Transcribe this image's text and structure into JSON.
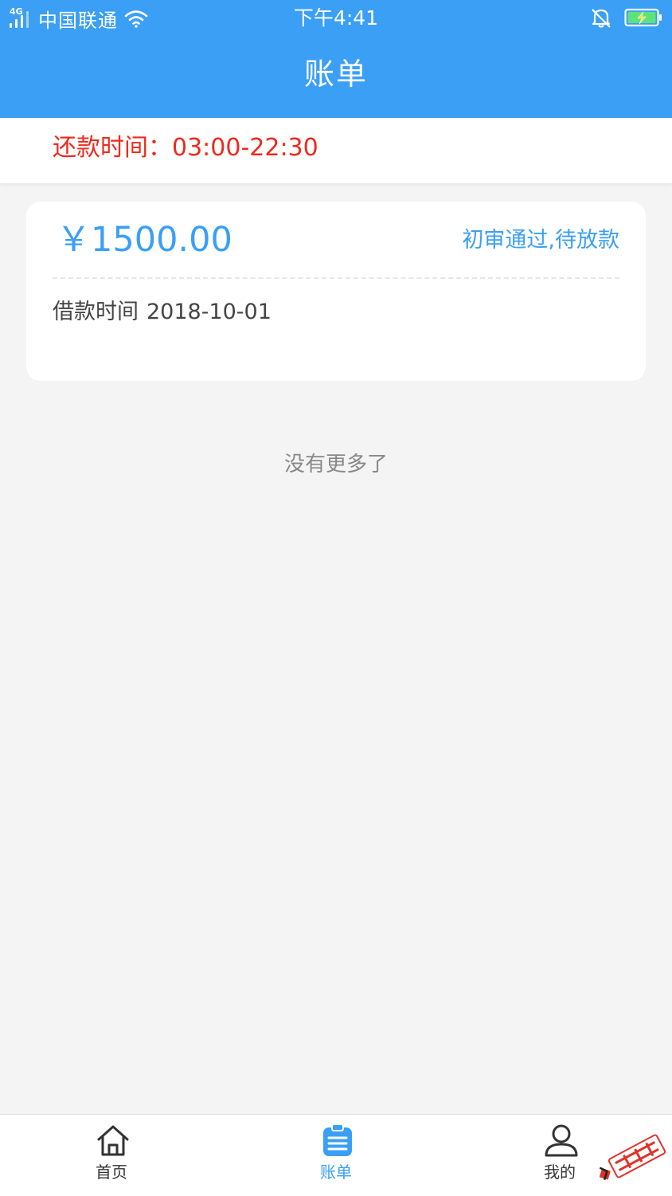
{
  "status_bar": {
    "network": "4G",
    "carrier": "中国联通",
    "time": "下午4:41"
  },
  "header": {
    "title": "账单"
  },
  "notice": {
    "text": "还款时间：03:00-22:30"
  },
  "loan_card": {
    "amount": "￥1500.00",
    "status": "初审通过,待放款",
    "date_label": "借款时间",
    "date_value": "2018-10-01"
  },
  "list_footer": {
    "text": "没有更多了"
  },
  "tab_bar": {
    "tabs": [
      {
        "label": "首页",
        "icon": "home-icon"
      },
      {
        "label": "账单",
        "icon": "bill-icon",
        "active": true
      },
      {
        "label": "我的",
        "icon": "user-icon"
      }
    ]
  },
  "colors": {
    "primary": "#3a9ff5",
    "notice_red": "#ee2a1d",
    "background": "#f4f4f4"
  }
}
